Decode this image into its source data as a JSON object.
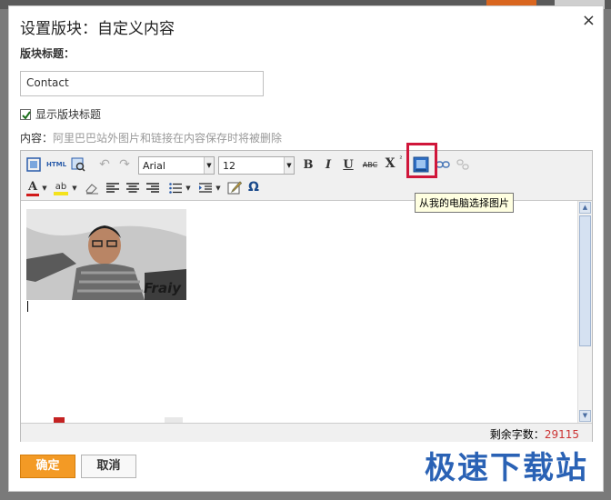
{
  "dialog": {
    "title": "设置版块：自定义内容",
    "close_glyph": "×",
    "block_title_label": "版块标题：",
    "block_title_value": "Contact",
    "show_title_checkbox": {
      "label": "显示版块标题",
      "checked": true
    },
    "content_label": "内容：",
    "content_hint": "阿里巴巴站外图片和链接在内容保存时将被删除"
  },
  "toolbar": {
    "row1": [
      {
        "name": "fullscreen-icon"
      },
      {
        "name": "html-source-icon",
        "text": "HTML"
      },
      {
        "name": "preview-icon"
      },
      {
        "name": "undo-icon"
      },
      {
        "name": "redo-icon"
      },
      {
        "name": "font-family-select",
        "value": "Arial"
      },
      {
        "name": "font-size-select",
        "value": "12"
      },
      {
        "name": "bold-icon",
        "text": "B"
      },
      {
        "name": "italic-icon",
        "text": "I"
      },
      {
        "name": "underline-icon",
        "text": "U"
      },
      {
        "name": "strikethrough-icon",
        "text": "ABC"
      },
      {
        "name": "superscript-icon",
        "text": "X"
      },
      {
        "name": "insert-image-icon"
      },
      {
        "name": "link-icon"
      },
      {
        "name": "unlink-icon"
      }
    ],
    "row2": [
      {
        "name": "font-color-icon",
        "text": "A"
      },
      {
        "name": "highlight-color-icon",
        "text": "ab"
      },
      {
        "name": "eraser-icon"
      },
      {
        "name": "align-left-icon"
      },
      {
        "name": "align-center-icon"
      },
      {
        "name": "align-right-icon"
      },
      {
        "name": "list-icon"
      },
      {
        "name": "indent-icon"
      },
      {
        "name": "edit-icon"
      },
      {
        "name": "special-char-icon",
        "text": "Ω"
      }
    ],
    "tooltip": "从我的电脑选择图片"
  },
  "editor": {
    "image_caption": "Fraiy",
    "remaining_label": "剩余字数：",
    "remaining_value": "29115"
  },
  "buttons": {
    "ok": "确定",
    "cancel": "取消"
  },
  "watermark": "极速下载站",
  "colors": {
    "accent": "#f39a25",
    "highlight_border": "#d0163a",
    "count": "#cc3333",
    "watermark": "#2a62b5"
  }
}
